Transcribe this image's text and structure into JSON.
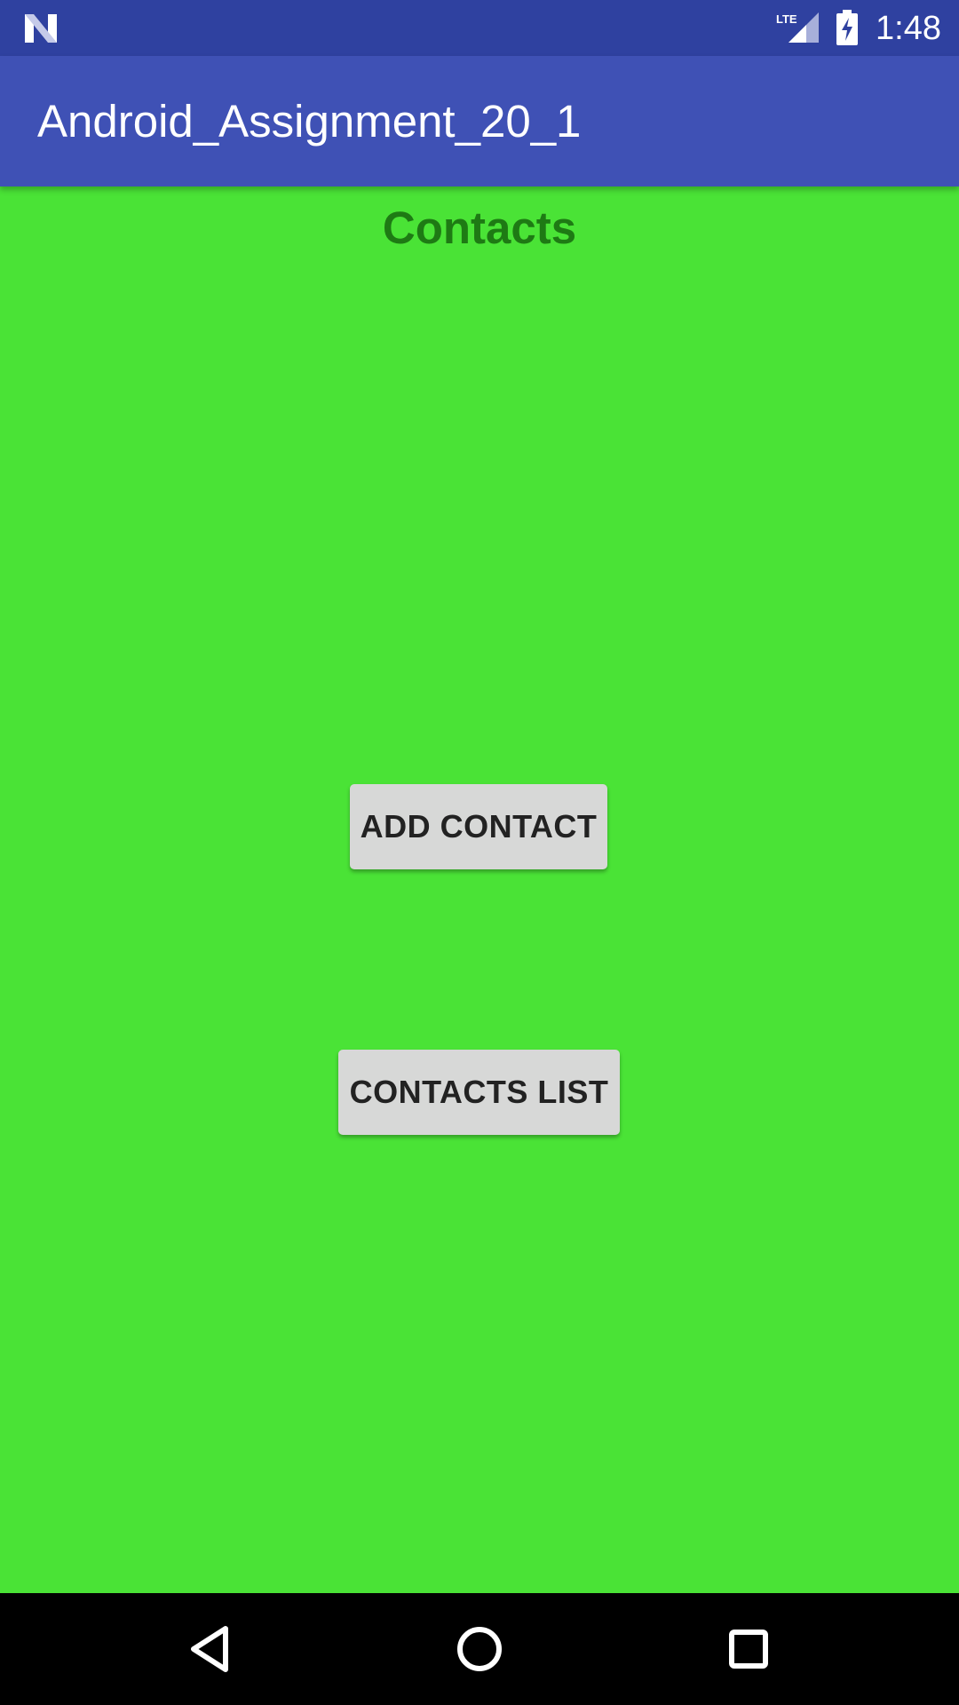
{
  "status_bar": {
    "time": "1:48",
    "network_label": "LTE",
    "icons": [
      "nougat-logo-icon",
      "lte-signal-icon",
      "battery-charging-icon"
    ]
  },
  "app_bar": {
    "title": "Android_Assignment_20_1",
    "background_color": "#3f51b5"
  },
  "main": {
    "heading": "Contacts",
    "background_color": "#4ae336",
    "buttons": {
      "add_contact": "ADD CONTACT",
      "contacts_list": "CONTACTS LIST"
    }
  },
  "nav_bar": {
    "icons": [
      "back-icon",
      "home-icon",
      "recents-icon"
    ]
  }
}
